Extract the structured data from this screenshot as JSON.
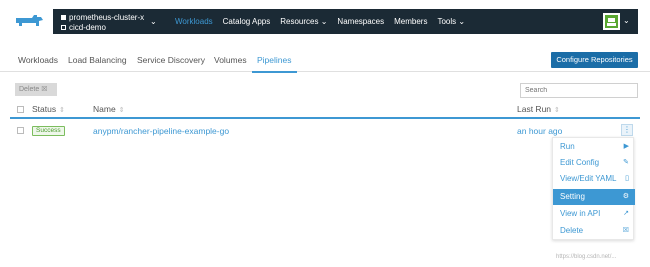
{
  "header": {
    "cluster_name": "prometheus-cluster-x",
    "project_name": "cicd-demo",
    "nav": [
      {
        "label": "Workloads"
      },
      {
        "label": "Catalog Apps"
      },
      {
        "label": "Resources ⌄"
      },
      {
        "label": "Namespaces"
      },
      {
        "label": "Members"
      },
      {
        "label": "Tools ⌄"
      }
    ],
    "colors": {
      "bar": "#1b2a35",
      "accent": "#3d98d3"
    }
  },
  "tabs": [
    {
      "label": "Workloads"
    },
    {
      "label": "Load Balancing"
    },
    {
      "label": "Service Discovery"
    },
    {
      "label": "Volumes"
    },
    {
      "label": "Pipelines"
    }
  ],
  "toolbar": {
    "configure_label": "Configure Repositories",
    "delete_label": "Delete",
    "search_placeholder": "Search"
  },
  "table": {
    "columns": {
      "status": "Status",
      "name": "Name",
      "last_run": "Last Run"
    },
    "rows": [
      {
        "status": "Success",
        "name": "anypm/rancher-pipeline-example-go",
        "last_run": "an hour ago"
      }
    ]
  },
  "menu": {
    "items": [
      {
        "label": "Run",
        "icon": "play-icon",
        "glyph": "▶"
      },
      {
        "label": "Edit Config",
        "icon": "pencil-icon",
        "glyph": "✎"
      },
      {
        "label": "View/Edit YAML",
        "icon": "file-icon",
        "glyph": "▯"
      },
      {
        "label": "Setting",
        "icon": "gear-icon",
        "glyph": "⚙"
      },
      {
        "label": "View in API",
        "icon": "external-link-icon",
        "glyph": "↗"
      },
      {
        "label": "Delete",
        "icon": "trash-icon",
        "glyph": "☒"
      }
    ]
  },
  "watermark": "https://blog.csdn.net/..."
}
